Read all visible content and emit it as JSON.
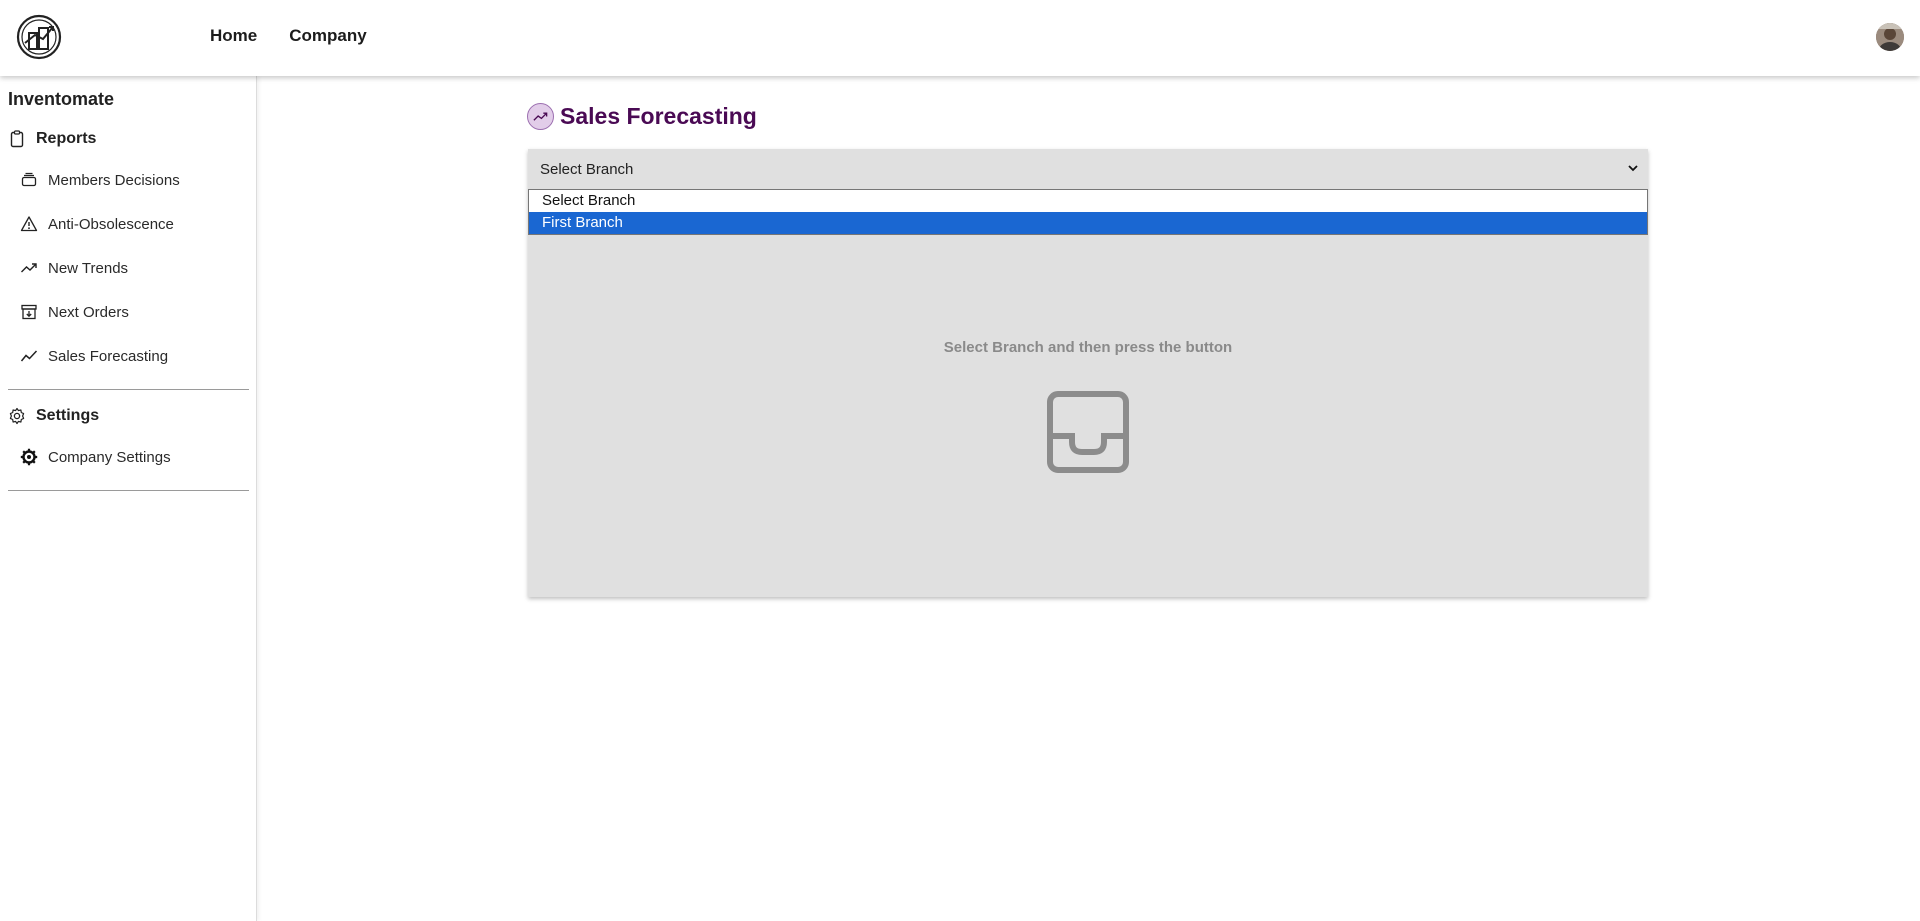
{
  "topbar": {
    "nav": [
      {
        "label": "Home"
      },
      {
        "label": "Company"
      }
    ]
  },
  "sidebar": {
    "brand": "Inventomate",
    "sections": {
      "reports": {
        "label": "Reports",
        "items": [
          {
            "label": "Members Decisions",
            "icon": "stack-icon"
          },
          {
            "label": "Anti-Obsolescence",
            "icon": "warning-icon"
          },
          {
            "label": "New Trends",
            "icon": "trend-up-icon"
          },
          {
            "label": "Next Orders",
            "icon": "archive-down-icon"
          },
          {
            "label": "Sales Forecasting",
            "icon": "line-chart-icon"
          }
        ]
      },
      "settings": {
        "label": "Settings",
        "items": [
          {
            "label": "Company Settings",
            "icon": "gear-icon"
          }
        ]
      }
    }
  },
  "main": {
    "title": "Sales Forecasting",
    "branch_select": {
      "value": "Select Branch",
      "options": [
        {
          "label": "Select Branch",
          "selected": false
        },
        {
          "label": "First Branch",
          "selected": true
        }
      ]
    },
    "empty_message": "Select Branch and then press the button"
  },
  "colors": {
    "title": "#4a0a54",
    "selected_option": "#1a67d2",
    "panel_bg": "#e0e0e0"
  }
}
